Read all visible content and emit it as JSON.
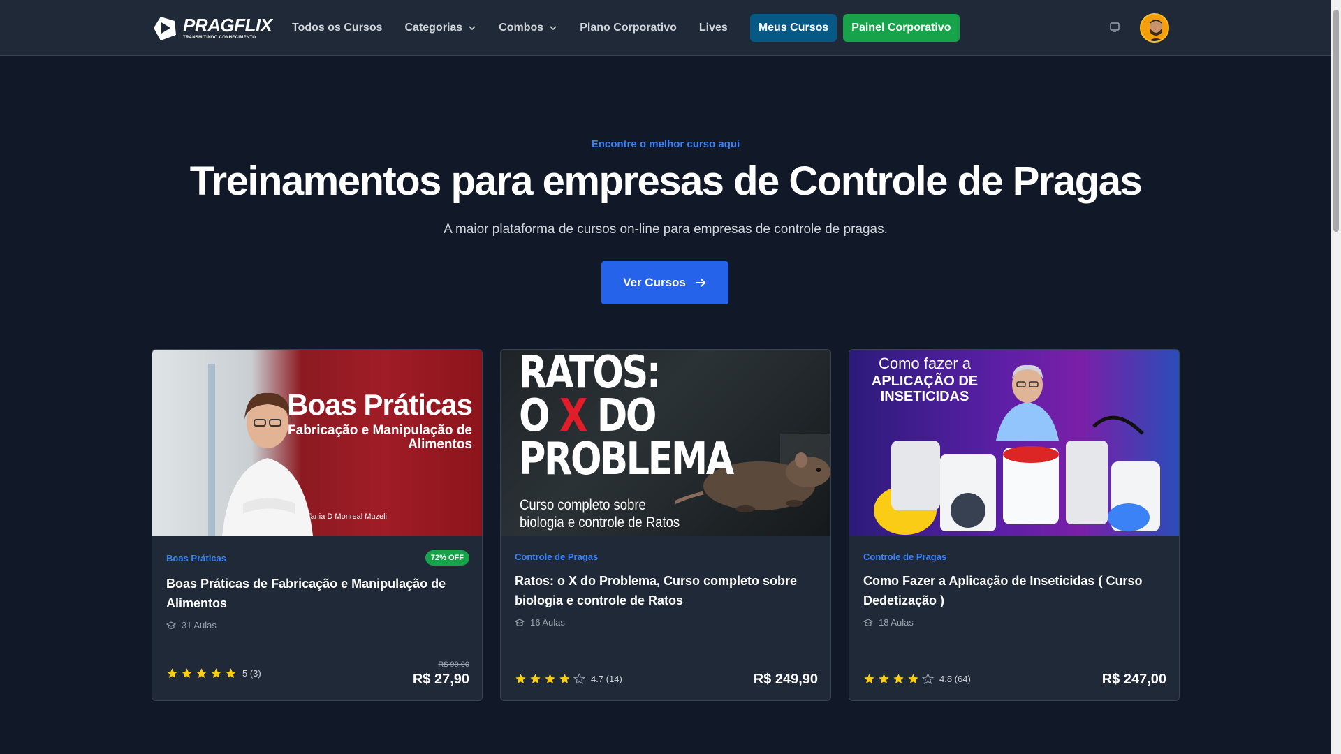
{
  "brand": {
    "name": "PRAGFLIX",
    "tagline": "TRANSMITINDO CONHECIMENTO"
  },
  "nav": {
    "links": [
      "Todos os Cursos",
      "Categorias",
      "Combos",
      "Plano Corporativo",
      "Lives"
    ],
    "meus_cursos": "Meus Cursos",
    "painel": "Painel Corporativo",
    "icons": [
      "chevron-down-icon",
      "device-icon",
      "avatar"
    ]
  },
  "hero": {
    "eyebrow": "Encontre o melhor curso aqui",
    "title": "Treinamentos para empresas de Controle de Pragas",
    "subtitle": "A maior plataforma de cursos on-line para empresas de controle de pragas.",
    "cta": "Ver Cursos"
  },
  "cards": [
    {
      "category": "Boas Práticas",
      "badge": "72% OFF",
      "title": "Boas Práticas de Fabricação e Manipulação de Alimentos",
      "lessons": "31 Aulas",
      "rating": "5 (3)",
      "rating_value": 5,
      "price_old": "R$ 99,00",
      "price": "R$ 27,90",
      "image": {
        "heading": "Boas Práticas",
        "sub": "Fabricação e Manipulação de Alimentos",
        "author": "Tania D Monreal Muzeli"
      }
    },
    {
      "category": "Controle de Pragas",
      "title": "Ratos: o X do Problema, Curso completo sobre biologia e controle de Ratos",
      "lessons": "16 Aulas",
      "rating": "4.7 (14)",
      "rating_value": 4.7,
      "price": "R$ 249,90",
      "image": {
        "line1": "RATOS:",
        "line2a": "O ",
        "line2x": "X",
        "line2b": " DO",
        "line3": "PROBLEMA",
        "sub1": "Curso completo sobre",
        "sub2": "biologia e controle de Ratos"
      }
    },
    {
      "category": "Controle de Pragas",
      "title": "Como Fazer a Aplicação de Inseticidas ( Curso Dedetização )",
      "lessons": "18 Aulas",
      "rating": "4.8 (64)",
      "rating_value": 4.8,
      "price": "R$ 247,00",
      "image": {
        "line1": "Como fazer a",
        "line2": "APLICAÇÃO DE",
        "line3": "INSETICIDAS"
      }
    }
  ],
  "colors": {
    "bg": "#111827",
    "nav": "#1f2937",
    "accent": "#2563eb",
    "green": "#16a34a",
    "star": "#facc15"
  }
}
